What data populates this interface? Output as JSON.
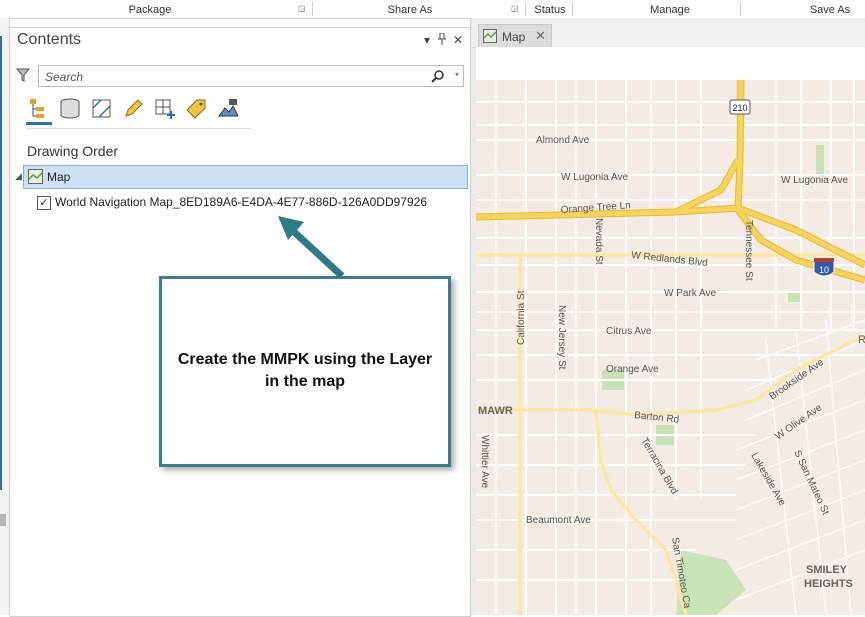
{
  "ribbon": {
    "groups": [
      "Package",
      "Share As",
      "Status",
      "Manage",
      "Save As"
    ]
  },
  "contents": {
    "title": "Contents",
    "search_placeholder": "Search",
    "section_title": "Drawing Order",
    "map_label": "Map",
    "layer": {
      "label": "World Navigation Map_8ED189A6-E4DA-4E77-886D-126A0DD97926",
      "checked": true,
      "check_glyph": "✓"
    },
    "pane_buttons": [
      "▾",
      "📌",
      "✕"
    ],
    "toolbar_icons": [
      "list-by-drawing-order-icon",
      "list-by-source-icon",
      "list-by-selection-icon",
      "list-by-editing-icon",
      "list-by-snapping-icon",
      "list-by-labeling-icon",
      "list-by-perspective-imagery-icon"
    ]
  },
  "callout": {
    "text": "Create the MMPK using the Layer in the map",
    "border_color": "#3b7f8c"
  },
  "map_view": {
    "tab_label": "Map",
    "tab_close": "✕",
    "streets": [
      "Almond Ave",
      "W Lugonia Ave",
      "W Lugonia Ave",
      "Orange Tree Ln",
      "W Redlands Blvd",
      "W Park Ave",
      "Citrus Ave",
      "Orange Ave",
      "Barton Rd",
      "Beaumont Ave",
      "California St",
      "New Jersey St",
      "Nevada St",
      "Tennessee St",
      "Whittier Ave",
      "Terracina Blvd",
      "San Timoteo Ca",
      "Brookside Ave",
      "W Olive Ave",
      "Lakeside Ave",
      "S San Mateo St",
      "MAWR",
      "SMILEY",
      "HEIGHTS",
      "R"
    ],
    "shields": [
      "210",
      "10"
    ],
    "colors": {
      "land": "#f4ece4",
      "highway": "#f7d35a",
      "park": "#c8e3b5",
      "road": "#ffffff"
    }
  }
}
